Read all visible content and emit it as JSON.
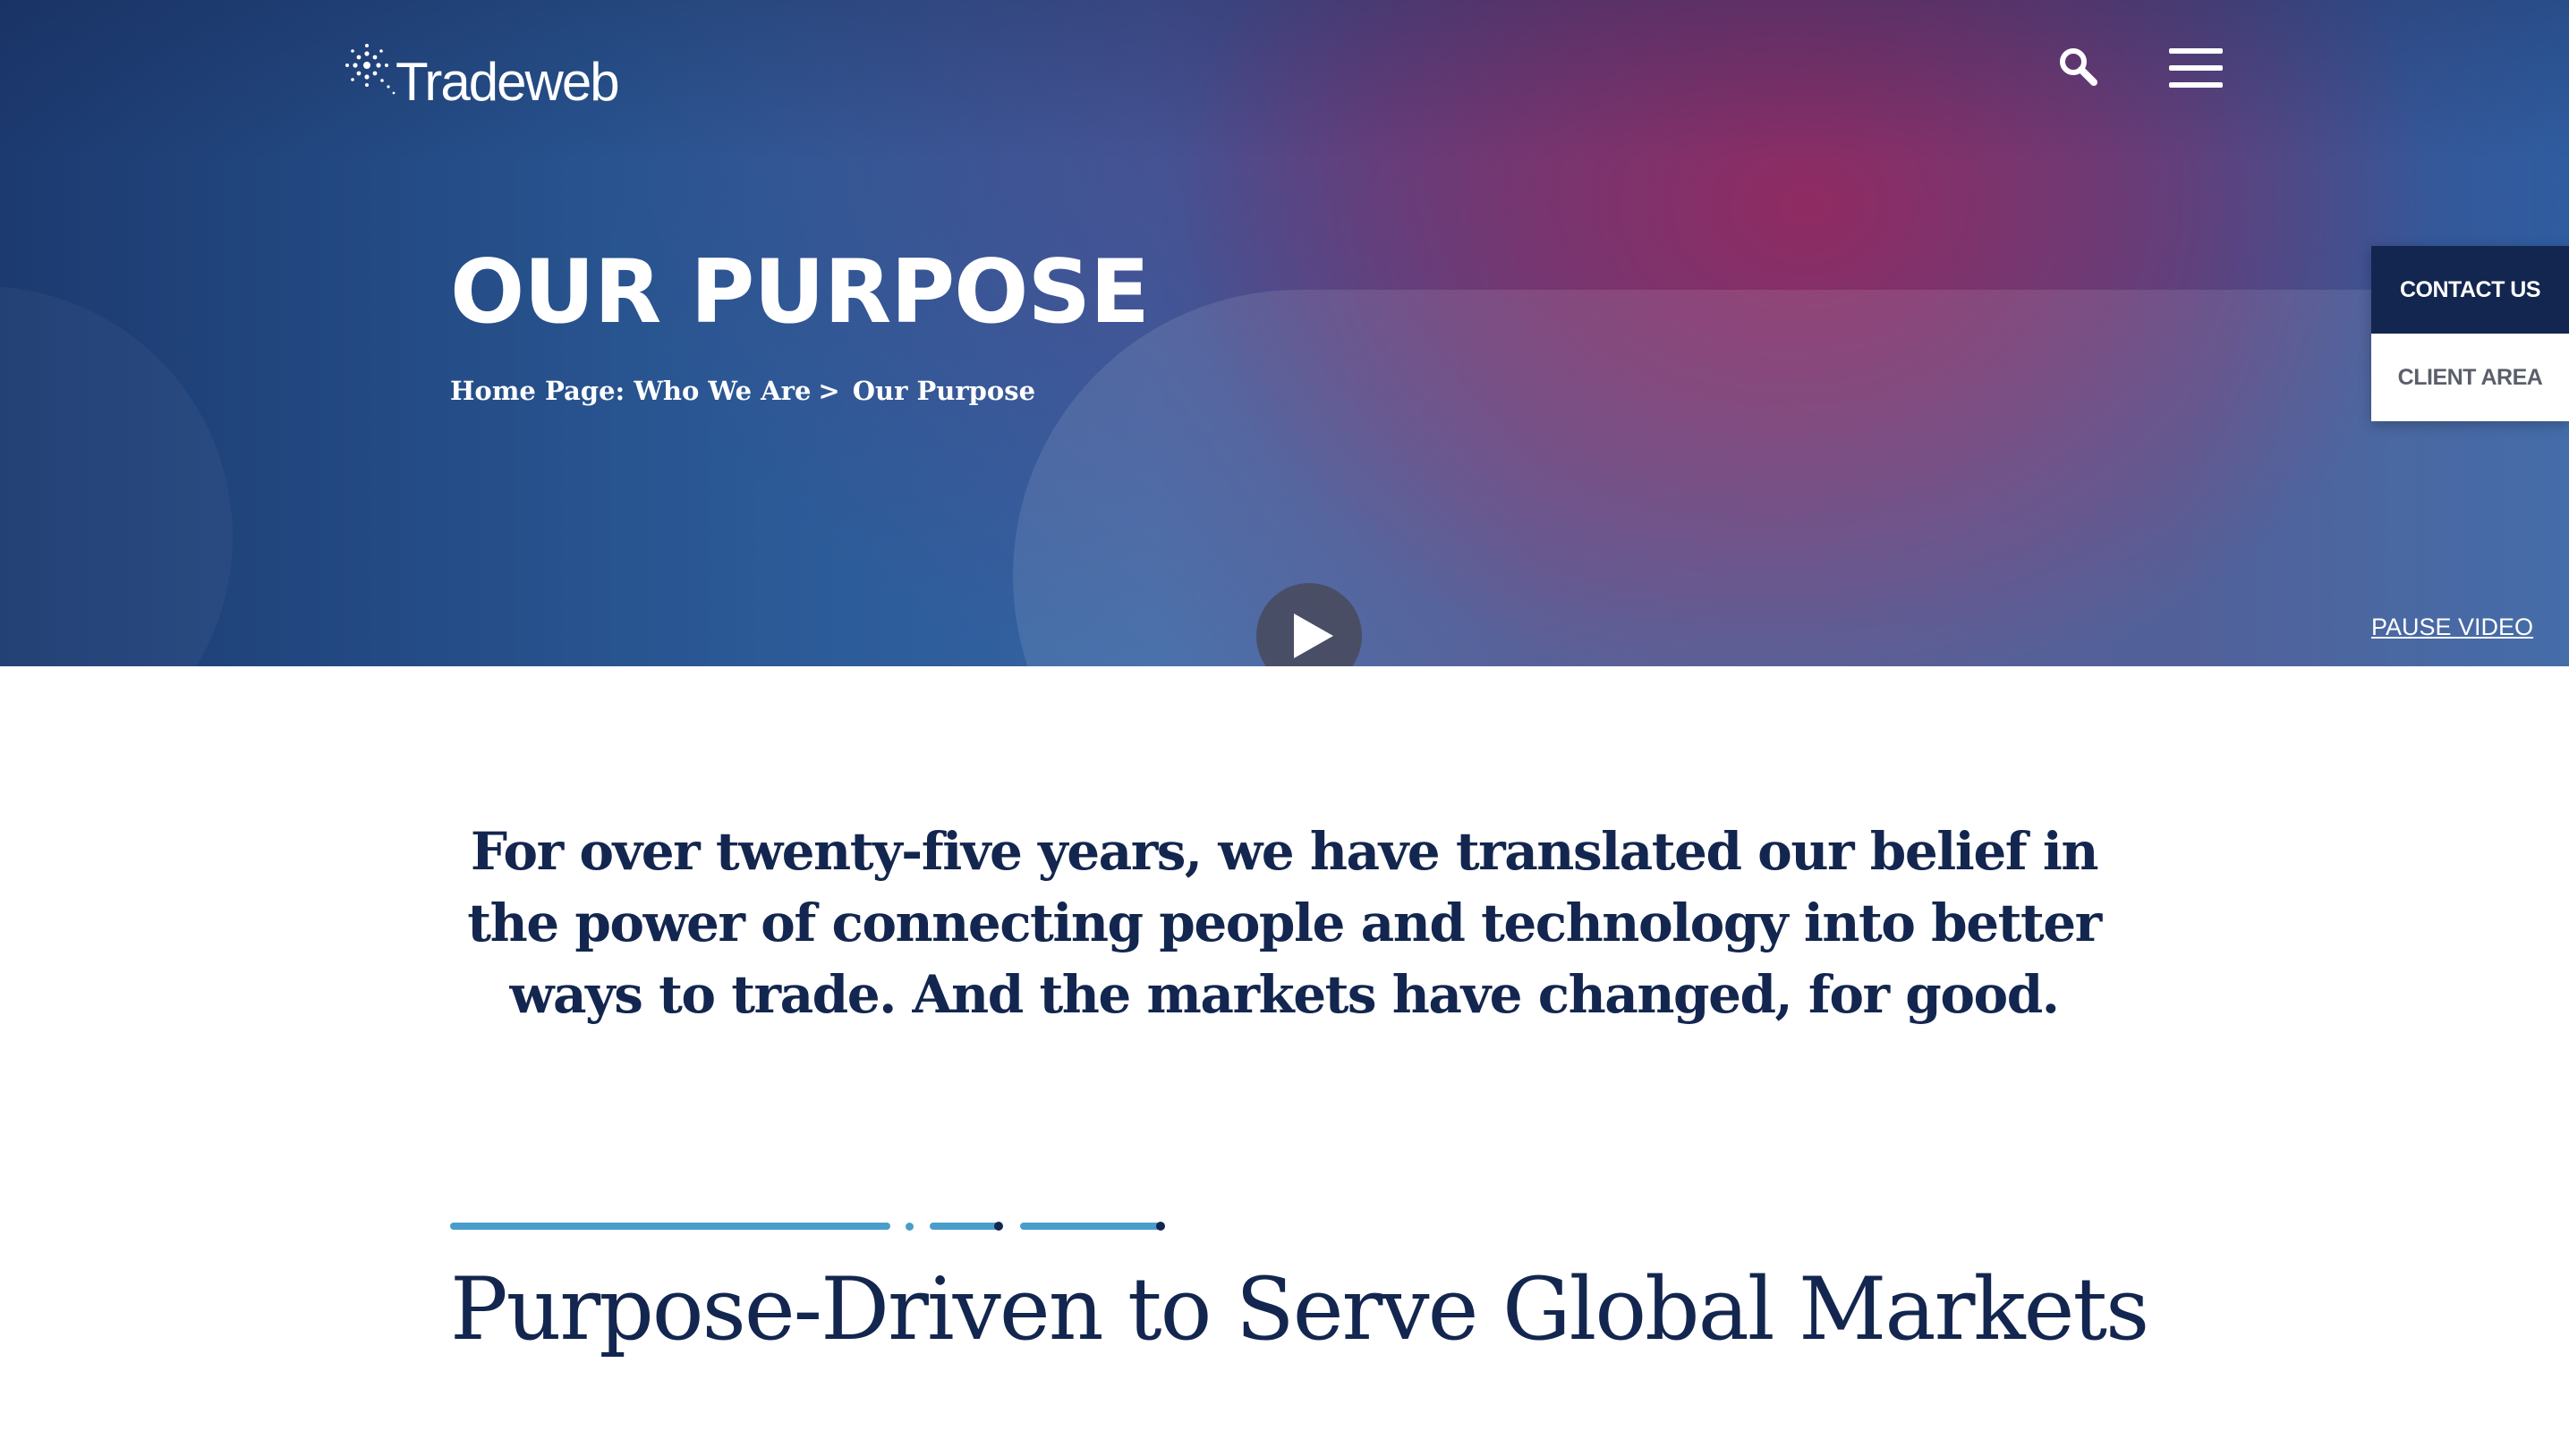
{
  "header": {
    "logo_text": "Tradeweb",
    "icons": {
      "search": "search-icon",
      "menu": "hamburger-menu-icon",
      "logo": "starburst-logo-icon"
    }
  },
  "hero": {
    "title": "OUR PURPOSE",
    "breadcrumb": {
      "items": [
        "Home Page:",
        "Who We Are"
      ],
      "separator": ">",
      "current": "Our Purpose"
    },
    "side_tabs": {
      "contact_label": "CONTACT US",
      "client_label": "CLIENT AREA"
    },
    "play_icon": "play-icon",
    "pause_video_label": "PAUSE VIDEO"
  },
  "main": {
    "intro_text": "For over twenty-five years, we have translated our belief in the power of connecting people and technology into better ways to trade. And the markets have changed, for good.",
    "section_title": "Purpose-Driven to Serve Global Markets"
  },
  "colors": {
    "navy": "#13264f",
    "accent_blue": "#4a9dcb",
    "hero_magenta": "#96285f",
    "hero_blue": "#2b5a97",
    "white": "#ffffff"
  }
}
